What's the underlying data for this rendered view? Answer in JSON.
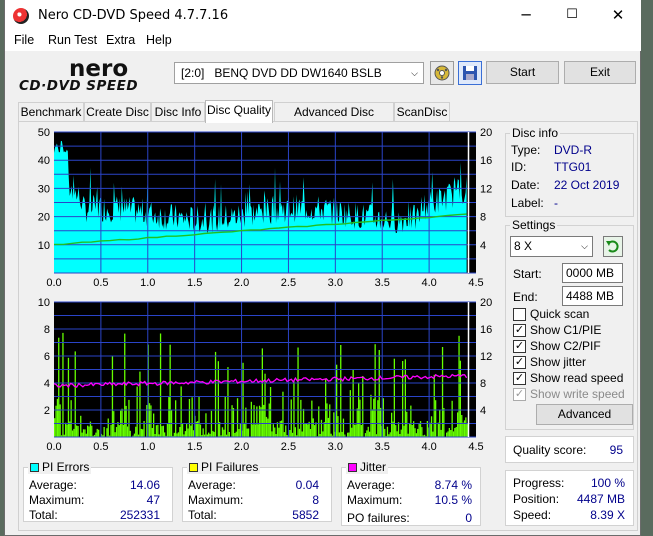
{
  "window": {
    "title": "Nero CD-DVD Speed 4.7.7.16",
    "minimize": "─",
    "maximize": "☐",
    "close": "✕"
  },
  "menu": [
    "File",
    "Run Test",
    "Extra",
    "Help"
  ],
  "logo": {
    "line1": "nero",
    "line2": "CD·DVD SPEED"
  },
  "toolbar": {
    "drive": "[2:0]   BENQ DVD DD DW1640 BSLB",
    "drive_arrow": "⌵",
    "start": "Start",
    "exit": "Exit",
    "icon1": "film-icon",
    "icon2": "save-icon"
  },
  "tabs": [
    "Benchmark",
    "Create Disc",
    "Disc Info",
    "Disc Quality",
    "Advanced Disc Quality",
    "ScanDisc"
  ],
  "active_tab": 3,
  "disc_info": {
    "legend": "Disc info",
    "type_label": "Type:",
    "type": "DVD-R",
    "id_label": "ID:",
    "id": "TTG01",
    "date_label": "Date:",
    "date": "22 Oct 2019",
    "label_label": "Label:",
    "label": "-"
  },
  "settings": {
    "legend": "Settings",
    "speed": "8 X",
    "speed_arrow": "⌵",
    "start_label": "Start:",
    "start": "0000 MB",
    "end_label": "End:",
    "end": "4488 MB",
    "checks": [
      {
        "label": "Quick scan",
        "checked": false,
        "enabled": true
      },
      {
        "label": "Show C1/PIE",
        "checked": true,
        "enabled": true
      },
      {
        "label": "Show C2/PIF",
        "checked": true,
        "enabled": true
      },
      {
        "label": "Show jitter",
        "checked": true,
        "enabled": true
      },
      {
        "label": "Show read speed",
        "checked": true,
        "enabled": true
      },
      {
        "label": "Show write speed",
        "checked": true,
        "enabled": false
      }
    ],
    "advanced": "Advanced"
  },
  "quality": {
    "label": "Quality score:",
    "value": "95"
  },
  "progress": {
    "progress_label": "Progress:",
    "progress": "100 %",
    "position_label": "Position:",
    "position": "4487 MB",
    "speed_label": "Speed:",
    "speed": "8.39 X"
  },
  "pi_errors": {
    "legend": "PI Errors",
    "color": "#00ffff",
    "average_label": "Average:",
    "average": "14.06",
    "maximum_label": "Maximum:",
    "maximum": "47",
    "total_label": "Total:",
    "total": "252331"
  },
  "pi_failures": {
    "legend": "PI Failures",
    "color": "#ffff00",
    "average_label": "Average:",
    "average": "0.04",
    "maximum_label": "Maximum:",
    "maximum": "8",
    "total_label": "Total:",
    "total": "5852"
  },
  "jitter": {
    "legend": "Jitter",
    "color": "#ff00ff",
    "average_label": "Average:",
    "average": "8.74 %",
    "maximum_label": "Maximum:",
    "maximum": "10.5 %",
    "po_label": "PO failures:",
    "po": "0"
  },
  "chart_data": [
    {
      "type": "area",
      "series": [
        {
          "values": "PI errors (cyan fill): ~30-40 at start, ~18-24 mid, rising to ~30 near end",
          "ref": "pi_errors"
        },
        {
          "values": "read speed (green line): 4 X at 0.0 GB rising to ~8.4 X at 4.4 GB"
        }
      ],
      "xlim": [
        0,
        4.5
      ],
      "ylim": [
        0,
        50
      ],
      "y2lim": [
        0,
        20
      ],
      "xticks": [
        "0.0",
        "0.5",
        "1.0",
        "1.5",
        "2.0",
        "2.5",
        "3.0",
        "3.5",
        "4.0",
        "4.5"
      ],
      "yticks": [
        "10",
        "20",
        "30",
        "40",
        "50"
      ],
      "y2ticks": [
        "4",
        "8",
        "12",
        "16",
        "20"
      ],
      "grid": true
    },
    {
      "type": "bar",
      "series": [
        {
          "values": "PI failures (green bars): mostly 0-4, peaks up to 8",
          "ref": "pi_failures"
        },
        {
          "values": "jitter (magenta line): ~7.5 % at start rising to ~9 % at end",
          "ref": "jitter"
        }
      ],
      "xlim": [
        0,
        4.5
      ],
      "ylim": [
        0,
        10
      ],
      "y2lim": [
        0,
        20
      ],
      "xticks": [
        "0.0",
        "0.5",
        "1.0",
        "1.5",
        "2.0",
        "2.5",
        "3.0",
        "3.5",
        "4.0",
        "4.5"
      ],
      "yticks": [
        "2",
        "4",
        "6",
        "8",
        "10"
      ],
      "y2ticks": [
        "4",
        "8",
        "12",
        "16",
        "20"
      ],
      "grid": true
    }
  ]
}
